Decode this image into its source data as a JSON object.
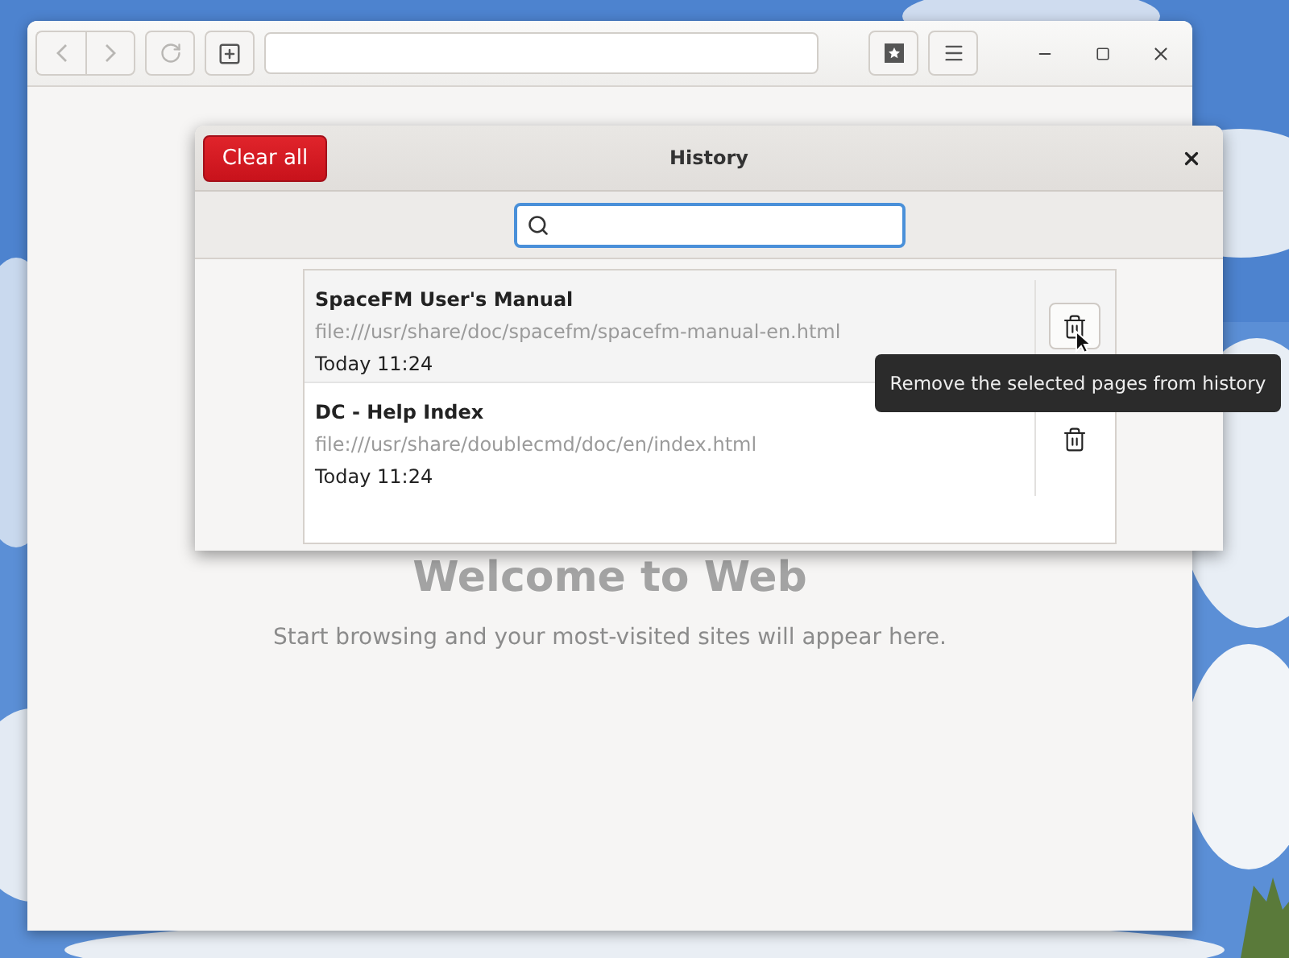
{
  "browser": {
    "welcome": {
      "title": "Welcome to Web",
      "subtitle": "Start browsing and your most-visited sites will appear here."
    }
  },
  "history_dialog": {
    "title": "History",
    "clear_button": "Clear all",
    "rows": [
      {
        "title": "SpaceFM User's Manual",
        "url": "file:///usr/share/doc/spacefm/spacefm-manual-en.html",
        "time": "Today 11:24",
        "hovered": true
      },
      {
        "title": "DC - Help Index",
        "url": "file:///usr/share/doublecmd/doc/en/index.html",
        "time": "Today 11:24",
        "hovered": false
      }
    ],
    "tooltip": "Remove the selected pages from history"
  }
}
